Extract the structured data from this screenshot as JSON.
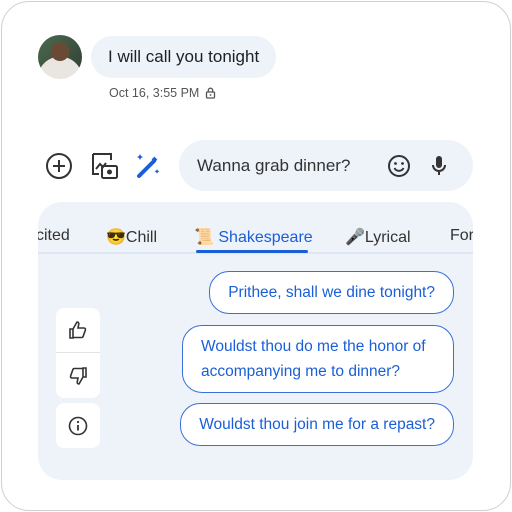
{
  "message": {
    "text": "I will call you tonight",
    "timestamp": "Oct 16, 3:55 PM"
  },
  "compose": {
    "value": "Wanna grab dinner?"
  },
  "tabs": [
    {
      "label": "cited"
    },
    {
      "emoji": "😎",
      "label": "Chill"
    },
    {
      "emoji": "📜",
      "label": "Shakespeare",
      "active": true
    },
    {
      "emoji": "🎤",
      "label": "Lyrical"
    },
    {
      "label": "For"
    }
  ],
  "suggestions": [
    "Prithee, shall we dine tonight?",
    "Wouldst thou do me the honor of accompanying me to dinner?",
    "Wouldst thou join me for a repast?"
  ],
  "colors": {
    "accent": "#1a5fd6",
    "bubble": "#eef2f9"
  }
}
